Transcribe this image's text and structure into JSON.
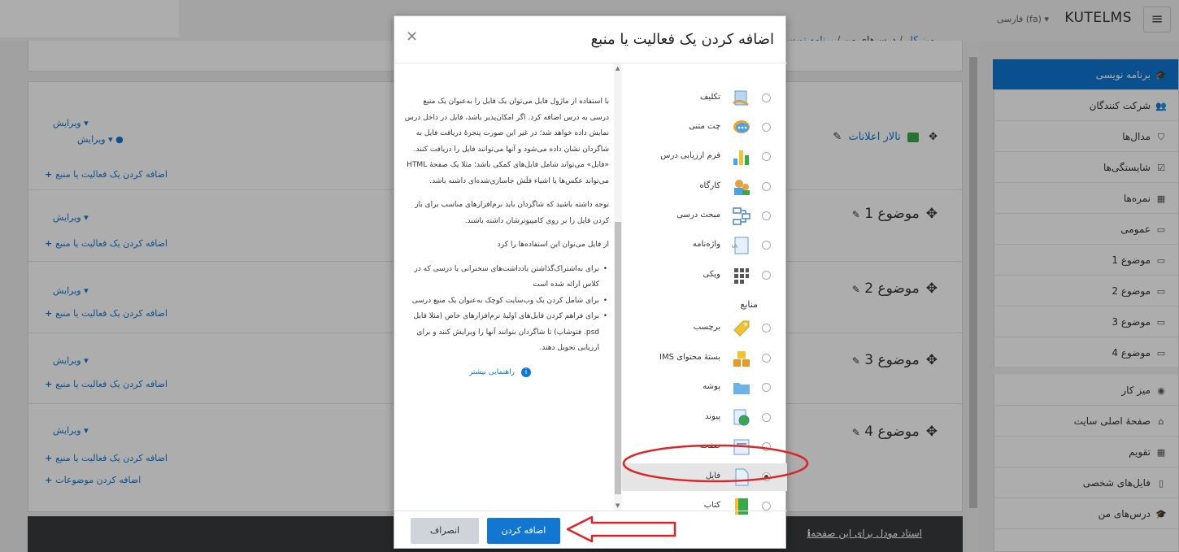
{
  "topbar": {
    "brand": "KUTELMS",
    "language": "فارسی ‎(fa)‎",
    "menu_icon": "hamburger-icon"
  },
  "breadcrumb": [
    "میز کار",
    "درس‌های من",
    "برنامه نویسی"
  ],
  "sections": [
    {
      "title": "تالار اعلانات",
      "edit": "ویرایش",
      "edit2": "ویرایش",
      "add": "اضافه کردن یک فعالیت یا منبع"
    },
    {
      "title": "موضوع 1",
      "edit": "ویرایش",
      "add": "اضافه کردن یک فعالیت یا منبع"
    },
    {
      "title": "موضوع 2",
      "edit": "ویرایش",
      "add": "اضافه کردن یک فعالیت یا منبع"
    },
    {
      "title": "موضوع 3",
      "edit": "ویرایش",
      "add": "اضافه کردن یک فعالیت یا منبع"
    },
    {
      "title": "موضوع 4",
      "edit": "ویرایش",
      "add": "اضافه کردن یک فعالیت یا منبع"
    }
  ],
  "add_topics": "اضافه کردن موضوعات",
  "footer": {
    "text": "استاد مودل برای این صفحه"
  },
  "sidebar": {
    "items": [
      {
        "label": "برنامه نویسی",
        "icon": "graduation-cap-icon"
      },
      {
        "label": "شرکت کنندگان",
        "icon": "users-icon"
      },
      {
        "label": "مدال‌ها",
        "icon": "shield-icon"
      },
      {
        "label": "شایستگی‌ها",
        "icon": "check-square-icon"
      },
      {
        "label": "نمره‌ها",
        "icon": "table-icon"
      },
      {
        "label": "عمومی",
        "icon": "folder-icon"
      },
      {
        "label": "موضوع 1",
        "icon": "folder-icon"
      },
      {
        "label": "موضوع 2",
        "icon": "folder-icon"
      },
      {
        "label": "موضوع 3",
        "icon": "folder-icon"
      },
      {
        "label": "موضوع 4",
        "icon": "folder-icon"
      },
      {
        "label": "میز کار",
        "icon": "dashboard-icon"
      },
      {
        "label": "صفحهٔ اصلی سایت",
        "icon": "home-icon"
      },
      {
        "label": "تقویم",
        "icon": "calendar-icon"
      },
      {
        "label": "فایل‌های شخصی",
        "icon": "file-icon"
      },
      {
        "label": "درس‌های من",
        "icon": "graduation-cap-icon"
      }
    ]
  },
  "modal": {
    "title": "اضافه کردن یک فعالیت یا منبع",
    "close": "×",
    "activities": [
      {
        "label": "تکلیف",
        "icon": "assignment-icon"
      },
      {
        "label": "چت متنی",
        "icon": "chat-icon"
      },
      {
        "label": "فرم ارزیابی درس",
        "icon": "feedback-chart-icon"
      },
      {
        "label": "کارگاه",
        "icon": "workshop-icon"
      },
      {
        "label": "مبحث درسی",
        "icon": "lesson-icon"
      },
      {
        "label": "واژه‌نامه",
        "icon": "glossary-icon"
      },
      {
        "label": "ویکی",
        "icon": "wiki-icon"
      }
    ],
    "resources_heading": "منابع",
    "resources": [
      {
        "label": "برچسب",
        "icon": "label-tag-icon"
      },
      {
        "label": "بستهٔ محتوای IMS",
        "icon": "ims-package-icon"
      },
      {
        "label": "پوشه",
        "icon": "folder-icon"
      },
      {
        "label": "پیوند",
        "icon": "url-globe-icon"
      },
      {
        "label": "صفحه",
        "icon": "page-icon"
      },
      {
        "label": "فایل",
        "icon": "file-icon",
        "selected": true
      },
      {
        "label": "کتاب",
        "icon": "book-icon"
      }
    ],
    "help": {
      "p1": "با استفاده از ماژول فایل می‌توان یک فایل را به‌عنوان یک منبع درسی به درس اضافه کرد. اگر امکان‌پذیر باشد، فایل در داخل درس نمایش داده خواهد شد؛ در غیر این صورت پنجرهٔ دریافت فایل به شاگردان نشان داده می‌شود و آنها می‌توانند فایل را دریافت کنند. «فایل» می‌تواند شامل فایل‌های کمکی باشد؛ مثلا یک صفحهٔ HTML می‌تواند عکس‌ها یا اشیاء فلَش جاسازی‌شده‌ای داشته باشد.",
      "p2": "توجه داشته باشید که شاگردان باید نرم‌افزارهای مناسب برای باز کردن فایل را بر روی کامپیوترشان داشته باشند.",
      "p3": "از فایل می‌توان این استفاده‌ها را کرد",
      "bullets": [
        "برای به‌اشتراک‌گذاشتن یادداشت‌های سخنرانی یا درسی که در کلاس ارائه شده است",
        "برای شامل کردن یک وب‌سایت کوچک به‌عنوان یک منبع درسی",
        "برای فراهم کردن فایل‌های اولیهٔ نرم‌افزارهای خاص (مثلا فایل psd. فتوشاپ) تا شاگردان بتوانند آنها را ویرایش کنند و برای ارزیابی تحویل دهند."
      ],
      "more": "راهنمایی بیشتر"
    },
    "add_button": "اضافه کردن",
    "cancel_button": "انصراف"
  },
  "colors": {
    "accent": "#1177d1",
    "annotation": "#d9262c",
    "footer": "#373a3c"
  }
}
